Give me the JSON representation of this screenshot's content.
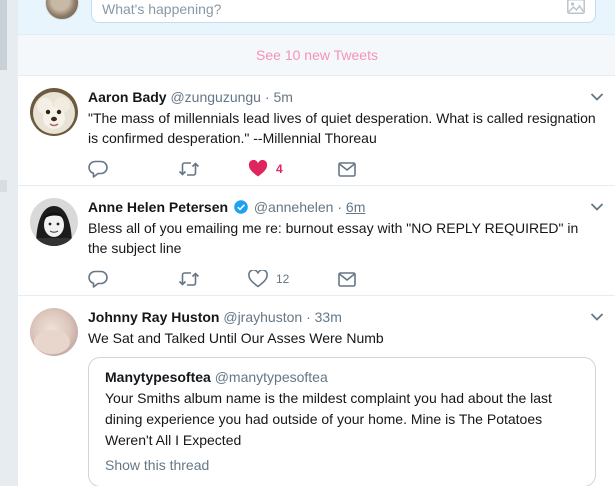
{
  "compose": {
    "placeholder": "What's happening?"
  },
  "new_tweets_bar": {
    "label": "See 10 new Tweets"
  },
  "tweets": [
    {
      "name": "Aaron Bady",
      "handle": "@zunguzungu",
      "separator": "·",
      "time": "5m",
      "verified": false,
      "text": "\"The mass of millennials lead lives of quiet desperation. What is called resignation is confirmed desperation.\" --Millennial Thoreau",
      "reply_count": "",
      "retweet_count": "",
      "like_count": "4",
      "liked": true
    },
    {
      "name": "Anne Helen Petersen",
      "handle": "@annehelen",
      "separator": "·",
      "time": "6m",
      "verified": true,
      "text": "Bless all of you emailing me re: burnout essay with \"NO REPLY REQUIRED\" in the subject line",
      "reply_count": "",
      "retweet_count": "",
      "like_count": "12",
      "liked": false
    },
    {
      "name": "Johnny Ray Huston",
      "handle": "@jrayhuston",
      "separator": "·",
      "time": "33m",
      "verified": false,
      "text": "We Sat and Talked Until Our Asses Were Numb",
      "quote": {
        "name": "Manytypesoftea",
        "handle": "@manytypesoftea",
        "text": "Your Smiths album name is the mildest complaint you had about the last dining experience you had outside of your home. Mine is The Potatoes Weren't All I Expected",
        "show_thread": "Show this thread"
      }
    }
  ],
  "icons": {
    "reply": "reply-icon",
    "retweet": "retweet-icon",
    "like": "heart-icon",
    "dm": "envelope-icon",
    "caret": "chevron-down-icon",
    "verified": "verified-badge-icon",
    "media": "image-icon"
  },
  "colors": {
    "like_active": "#e0245e",
    "new_tweets_text": "#f593b4",
    "verified": "#1da1f2",
    "secondary_text": "#657786",
    "icon": "#657786"
  }
}
